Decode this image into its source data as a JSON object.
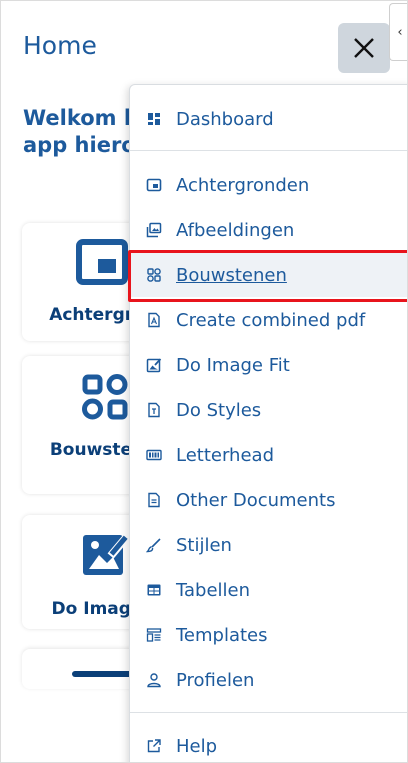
{
  "page": {
    "title": "Home"
  },
  "welcome": {
    "line1": "Welkom b",
    "line2": "app hiero"
  },
  "cards": [
    {
      "label": "Achtergro"
    },
    {
      "label": "Bouwsten"
    },
    {
      "label": "Do Image"
    }
  ],
  "menu": {
    "items": [
      {
        "label": "Dashboard",
        "icon": "dashboard-icon"
      },
      {
        "label": "Achtergronden",
        "icon": "background-icon"
      },
      {
        "label": "Afbeeldingen",
        "icon": "images-icon"
      },
      {
        "label": "Bouwstenen",
        "icon": "blocks-icon",
        "active": true
      },
      {
        "label": "Create combined pdf",
        "icon": "pdf-icon"
      },
      {
        "label": "Do Image Fit",
        "icon": "image-fit-icon"
      },
      {
        "label": "Do Styles",
        "icon": "styles-icon"
      },
      {
        "label": "Letterhead",
        "icon": "letterhead-icon"
      },
      {
        "label": "Other Documents",
        "icon": "document-icon"
      },
      {
        "label": "Stijlen",
        "icon": "brush-icon"
      },
      {
        "label": "Tabellen",
        "icon": "table-icon"
      },
      {
        "label": "Templates",
        "icon": "templates-icon"
      },
      {
        "label": "Profielen",
        "icon": "user-icon"
      },
      {
        "label": "Help",
        "icon": "external-link-icon"
      }
    ]
  },
  "colors": {
    "accent": "#1d5a9c",
    "dark_accent": "#0b3f78",
    "highlight": "#e8141c"
  }
}
